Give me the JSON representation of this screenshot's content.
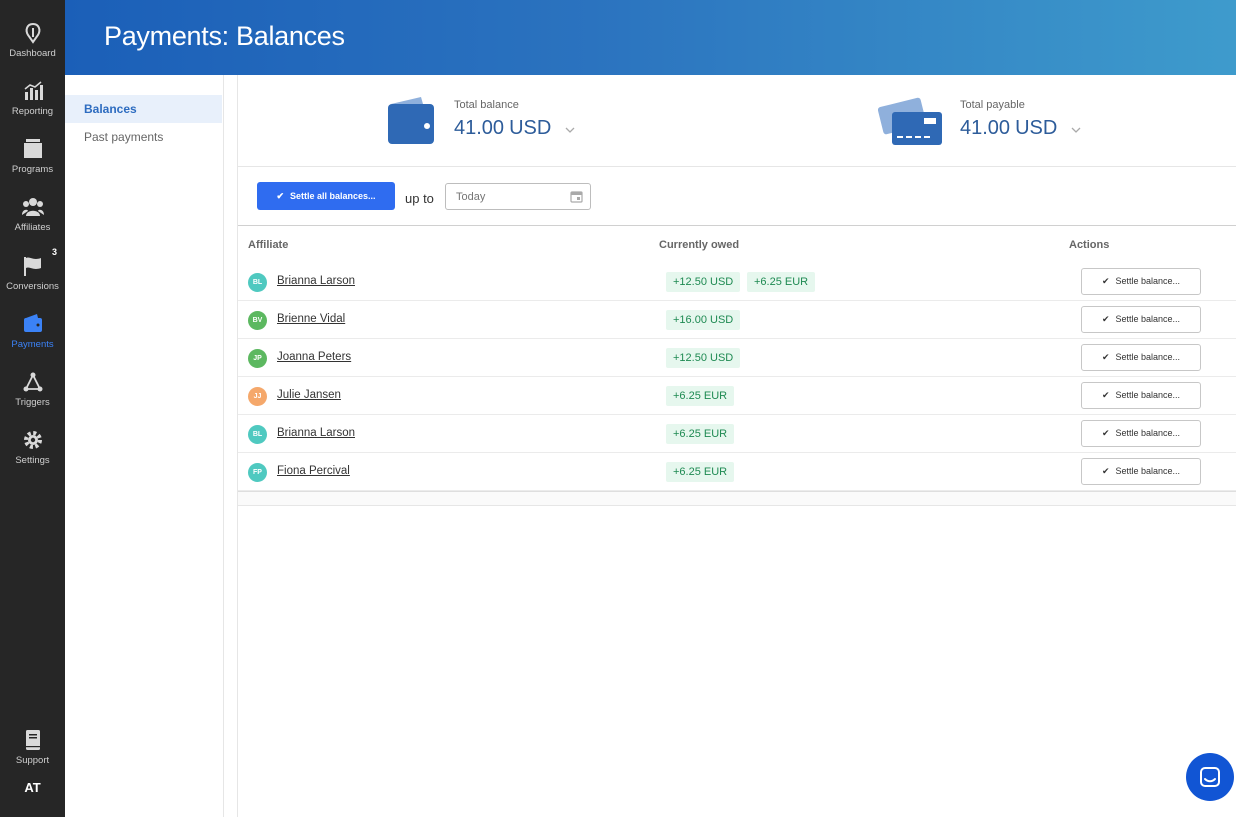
{
  "nav": {
    "items": [
      {
        "key": "dashboard",
        "label": "Dashboard"
      },
      {
        "key": "reporting",
        "label": "Reporting"
      },
      {
        "key": "programs",
        "label": "Programs"
      },
      {
        "key": "affiliates",
        "label": "Affiliates"
      },
      {
        "key": "conversions",
        "label": "Conversions",
        "badge": "3"
      },
      {
        "key": "payments",
        "label": "Payments",
        "active": true
      },
      {
        "key": "triggers",
        "label": "Triggers"
      },
      {
        "key": "settings",
        "label": "Settings"
      }
    ],
    "support_label": "Support",
    "user_initials": "AT"
  },
  "header": {
    "title": "Payments: Balances"
  },
  "subnav": {
    "items": [
      {
        "label": "Balances",
        "active": true
      },
      {
        "label": "Past payments"
      }
    ]
  },
  "summary": {
    "total_balance": {
      "label": "Total balance",
      "amount": "41.00",
      "currency": "USD"
    },
    "total_payable": {
      "label": "Total payable",
      "amount": "41.00",
      "currency": "USD"
    }
  },
  "toolbar": {
    "settle_all_label": "Settle all balances...",
    "up_to_label": "up to",
    "date_placeholder": "Today"
  },
  "table": {
    "columns": [
      "Affiliate",
      "Currently owed",
      "Actions"
    ],
    "settle_label": "Settle balance...",
    "rows": [
      {
        "initials": "BL",
        "avatar_color": "#4fc9c0",
        "name": "Brianna Larson",
        "owed": [
          "+12.50 USD",
          "+6.25 EUR"
        ]
      },
      {
        "initials": "BV",
        "avatar_color": "#5cb860",
        "name": "Brienne Vidal",
        "owed": [
          "+16.00 USD"
        ]
      },
      {
        "initials": "JP",
        "avatar_color": "#5cb860",
        "name": "Joanna Peters",
        "owed": [
          "+12.50 USD"
        ]
      },
      {
        "initials": "JJ",
        "avatar_color": "#f5a86b",
        "name": "Julie Jansen",
        "owed": [
          "+6.25 EUR"
        ]
      },
      {
        "initials": "BL",
        "avatar_color": "#4fc9c0",
        "name": "Brianna Larson",
        "owed": [
          "+6.25 EUR"
        ]
      },
      {
        "initials": "FP",
        "avatar_color": "#4fc9c0",
        "name": "Fiona Percival",
        "owed": [
          "+6.25 EUR"
        ]
      }
    ]
  },
  "colors": {
    "accent": "#2f6cf0",
    "header_start": "#1b5fb8",
    "header_end": "#3e9bcc",
    "owed_tag_bg": "#e6f7ee",
    "owed_tag_text": "#1e8a52"
  }
}
